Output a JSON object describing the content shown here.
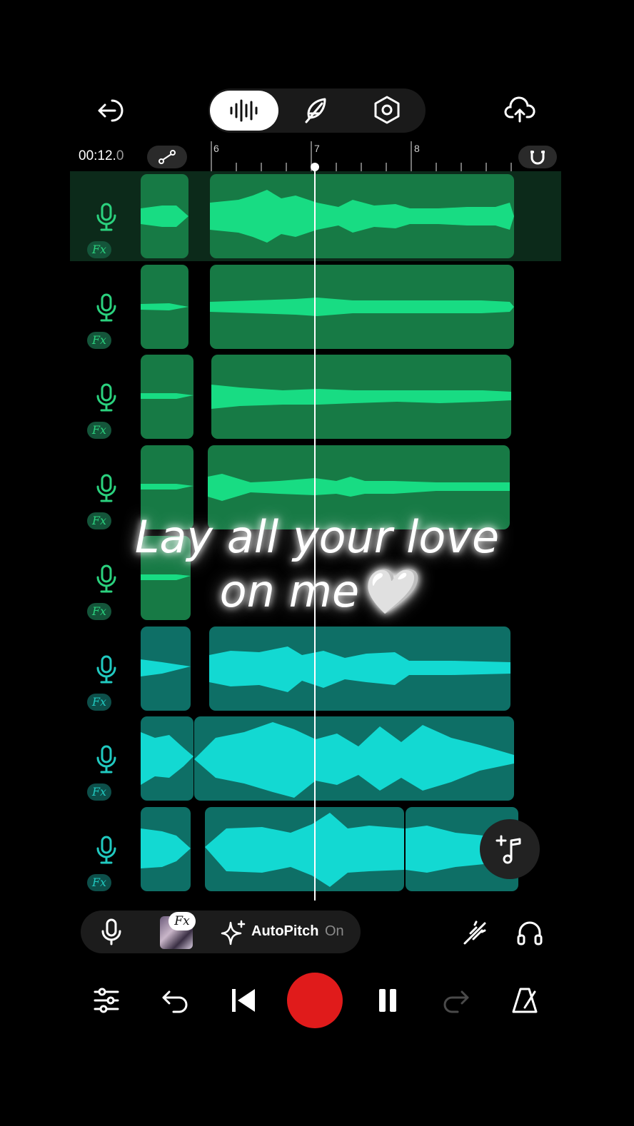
{
  "timeline": {
    "time_main": "00:12.",
    "time_ms": "0",
    "ruler_labels": [
      "6",
      "7",
      "8"
    ]
  },
  "tracks": [
    {
      "id": 1,
      "color": "green",
      "fx_label": "Fx",
      "icon": "microphone-icon",
      "selected": true
    },
    {
      "id": 2,
      "color": "green",
      "fx_label": "Fx",
      "icon": "microphone-icon"
    },
    {
      "id": 3,
      "color": "green",
      "fx_label": "Fx",
      "icon": "microphone-icon"
    },
    {
      "id": 4,
      "color": "green",
      "fx_label": "Fx",
      "icon": "microphone-icon"
    },
    {
      "id": 5,
      "color": "green",
      "fx_label": "Fx",
      "icon": "microphone-icon"
    },
    {
      "id": 6,
      "color": "teal",
      "fx_label": "Fx",
      "icon": "microphone-icon"
    },
    {
      "id": 7,
      "color": "teal",
      "fx_label": "Fx",
      "icon": "microphone-icon"
    },
    {
      "id": 8,
      "color": "teal",
      "fx_label": "Fx",
      "icon": "microphone-icon"
    }
  ],
  "lyrics": {
    "line1": "Lay all your love",
    "line2": "on me🤍"
  },
  "bottom_bar": {
    "fx_badge": "Fx",
    "autopitch_label": "AutoPitch",
    "autopitch_state": "On"
  },
  "colors": {
    "green_clip": "#177a45",
    "green_wave": "#18dc83",
    "teal_clip": "#0e6f66",
    "teal_wave": "#13d9d2",
    "record": "#e01b1b"
  }
}
